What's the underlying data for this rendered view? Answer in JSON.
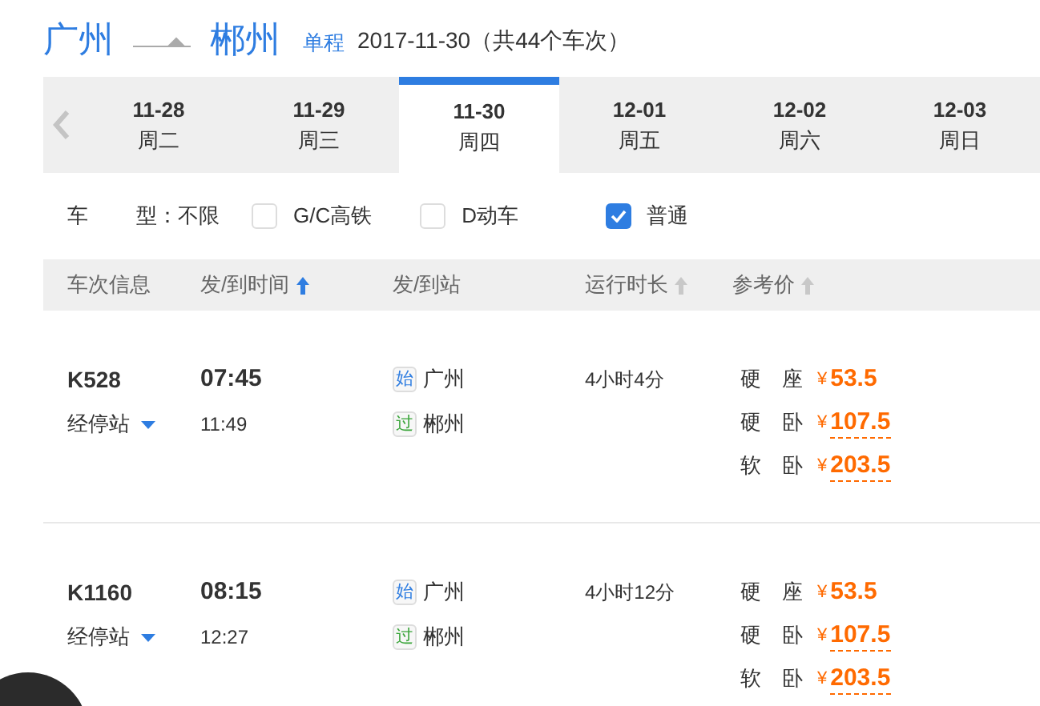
{
  "route": {
    "from": "广州",
    "to": "郴州",
    "trip_type": "单程",
    "summary": "2017-11-30（共44个车次）"
  },
  "dates": [
    {
      "date": "11-28",
      "weekday": "周二",
      "selected": false
    },
    {
      "date": "11-29",
      "weekday": "周三",
      "selected": false
    },
    {
      "date": "11-30",
      "weekday": "周四",
      "selected": true
    },
    {
      "date": "12-01",
      "weekday": "周五",
      "selected": false
    },
    {
      "date": "12-02",
      "weekday": "周六",
      "selected": false
    },
    {
      "date": "12-03",
      "weekday": "周日",
      "selected": false
    }
  ],
  "filters": {
    "label_a": "车",
    "label_b": "型：不限",
    "options": [
      {
        "label": "G/C高铁",
        "checked": false
      },
      {
        "label": "D动车",
        "checked": false
      },
      {
        "label": "普通",
        "checked": true
      }
    ]
  },
  "columns": [
    {
      "label": "车次信息",
      "sortable": false
    },
    {
      "label": "发/到时间",
      "sortable": true,
      "sort_active": true
    },
    {
      "label": "发/到站",
      "sortable": false
    },
    {
      "label": "运行时长",
      "sortable": true,
      "sort_active": false
    },
    {
      "label": "参考价",
      "sortable": true,
      "sort_active": false
    }
  ],
  "trains": [
    {
      "number": "K528",
      "stops_link": "经停站",
      "depart": "07:45",
      "arrive": "11:49",
      "stations": [
        {
          "badge": "始",
          "kind": "start",
          "name": "广州"
        },
        {
          "badge": "过",
          "kind": "pass",
          "name": "郴州"
        }
      ],
      "duration": "4小时4分",
      "prices": [
        {
          "seat": "硬　座",
          "price": "53.5",
          "underlined": false
        },
        {
          "seat": "硬　卧",
          "price": "107.5",
          "underlined": true
        },
        {
          "seat": "软　卧",
          "price": "203.5",
          "underlined": true
        }
      ]
    },
    {
      "number": "K1160",
      "stops_link": "经停站",
      "depart": "08:15",
      "arrive": "12:27",
      "stations": [
        {
          "badge": "始",
          "kind": "start",
          "name": "广州"
        },
        {
          "badge": "过",
          "kind": "pass",
          "name": "郴州"
        }
      ],
      "duration": "4小时12分",
      "prices": [
        {
          "seat": "硬　座",
          "price": "53.5",
          "underlined": false
        },
        {
          "seat": "硬　卧",
          "price": "107.5",
          "underlined": true
        },
        {
          "seat": "软　卧",
          "price": "203.5",
          "underlined": true
        }
      ]
    }
  ],
  "currency": "¥"
}
